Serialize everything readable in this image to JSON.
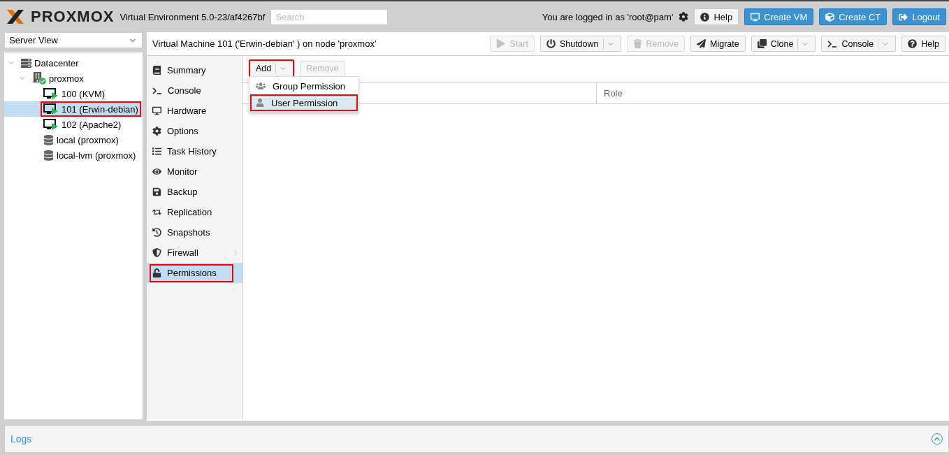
{
  "header": {
    "logo": "PROXMOX",
    "version": "Virtual Environment 5.0-23/af4267bf",
    "search": {
      "placeholder": "Search"
    },
    "user": "You are logged in as 'root@pam'",
    "buttons": [
      {
        "label": "Help",
        "kind": "plain"
      },
      {
        "label": "Create VM",
        "kind": "primary"
      },
      {
        "label": "Create CT",
        "kind": "primary"
      },
      {
        "label": "Logout",
        "kind": "primary"
      }
    ]
  },
  "view_selector": {
    "value": "Server View"
  },
  "tree": [
    {
      "label": "Datacenter",
      "kind": "datacenter",
      "expanded": true,
      "selected": false,
      "highlighted": false,
      "children": [
        {
          "label": "proxmox",
          "kind": "node",
          "expanded": true,
          "selected": false,
          "highlighted": false,
          "children": [
            {
              "label": "100 (KVM)",
              "kind": "vm",
              "selected": false,
              "highlighted": false
            },
            {
              "label": "101 (Erwin-debian)",
              "kind": "vm",
              "selected": true,
              "highlighted": true
            },
            {
              "label": "102 (Apache2)",
              "kind": "vm",
              "selected": false,
              "highlighted": false
            },
            {
              "label": "local (proxmox)",
              "kind": "storage",
              "selected": false,
              "highlighted": false
            },
            {
              "label": "local-lvm (proxmox)",
              "kind": "storage",
              "selected": false,
              "highlighted": false
            }
          ]
        }
      ]
    }
  ],
  "content": {
    "title": "Virtual Machine 101 ('Erwin-debian' ) on node 'proxmox'",
    "toolbar": [
      {
        "label": "Start",
        "disabled": true,
        "split": false
      },
      {
        "label": "Shutdown",
        "disabled": false,
        "split": true
      },
      {
        "label": "Remove",
        "disabled": true,
        "split": false
      },
      {
        "label": "Migrate",
        "disabled": false,
        "split": false
      },
      {
        "label": "Clone",
        "disabled": false,
        "split": true
      },
      {
        "label": "Console",
        "disabled": false,
        "split": true
      },
      {
        "label": "Help",
        "disabled": false,
        "split": false
      }
    ],
    "nav": [
      {
        "label": "Summary",
        "selected": false,
        "highlighted": false,
        "submenu": false
      },
      {
        "label": "Console",
        "selected": false,
        "highlighted": false,
        "submenu": false
      },
      {
        "label": "Hardware",
        "selected": false,
        "highlighted": false,
        "submenu": false
      },
      {
        "label": "Options",
        "selected": false,
        "highlighted": false,
        "submenu": false
      },
      {
        "label": "Task History",
        "selected": false,
        "highlighted": false,
        "submenu": false
      },
      {
        "label": "Monitor",
        "selected": false,
        "highlighted": false,
        "submenu": false
      },
      {
        "label": "Backup",
        "selected": false,
        "highlighted": false,
        "submenu": false
      },
      {
        "label": "Replication",
        "selected": false,
        "highlighted": false,
        "submenu": false
      },
      {
        "label": "Snapshots",
        "selected": false,
        "highlighted": false,
        "submenu": false
      },
      {
        "label": "Firewall",
        "selected": false,
        "highlighted": false,
        "submenu": true
      },
      {
        "label": "Permissions",
        "selected": true,
        "highlighted": true,
        "submenu": false
      }
    ],
    "permissions": {
      "toolbar": [
        {
          "label": "Add",
          "disabled": false,
          "highlighted": true,
          "split": true
        },
        {
          "label": "Remove",
          "disabled": true,
          "highlighted": false,
          "split": false
        }
      ],
      "columns": [
        "Role"
      ],
      "menu": [
        {
          "label": "Group Permission",
          "selected": false,
          "highlighted": false
        },
        {
          "label": "User Permission",
          "selected": true,
          "highlighted": true
        }
      ]
    }
  },
  "logs": {
    "title": "Logs",
    "expanded": false
  }
}
